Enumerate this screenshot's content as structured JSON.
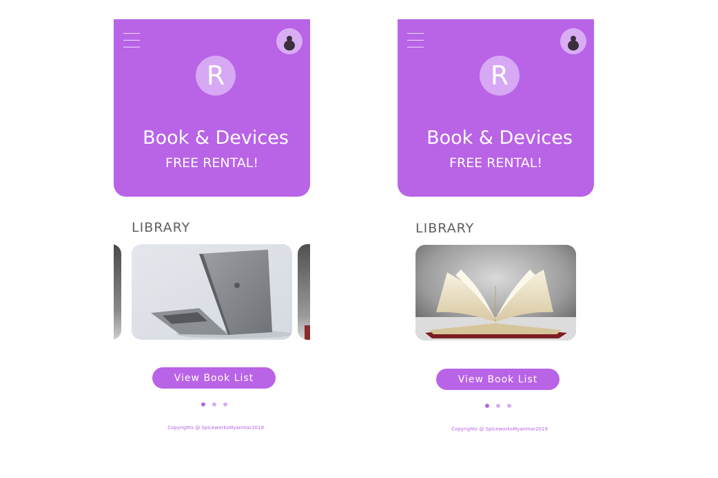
{
  "colors": {
    "primary": "#b963e7",
    "primary_light": "#d9adf4",
    "text_muted": "#5e5e5e"
  },
  "screens": [
    {
      "menu_icon": "hamburger-menu-icon",
      "user_icon": "user-avatar-icon",
      "logo_letter": "R",
      "hero_title": "Book & Devices",
      "hero_subtitle": "FREE RENTAL!",
      "section_label": "LIBRARY",
      "carousel_active_image": "laptop",
      "cta_label": "View Book List",
      "pagination": {
        "total": 3,
        "active": 1
      },
      "footer": "Copyrights @ SpiceworksMyanmar2019"
    },
    {
      "menu_icon": "hamburger-menu-icon",
      "user_icon": "user-avatar-icon",
      "logo_letter": "R",
      "hero_title": "Book & Devices",
      "hero_subtitle": "FREE RENTAL!",
      "section_label": "LIBRARY",
      "carousel_active_image": "open-book",
      "cta_label": "View Book List",
      "pagination": {
        "total": 3,
        "active": 1
      },
      "footer": "Copyrights @ SpiceworksMyanmar2019"
    }
  ]
}
